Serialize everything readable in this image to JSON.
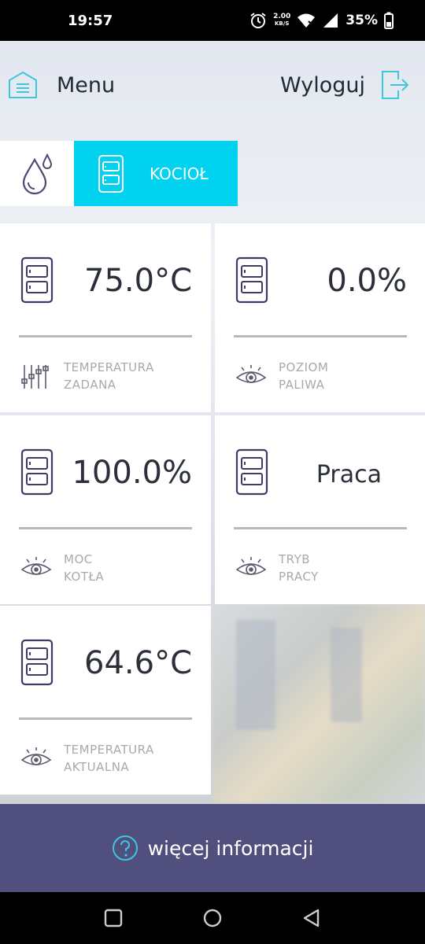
{
  "status_bar": {
    "time": "19:57",
    "net_speed_value": "2.00",
    "net_speed_unit": "KB/S",
    "battery": "35%"
  },
  "header": {
    "menu_label": "Menu",
    "logout_label": "Wyloguj",
    "accent_color": "#3cc8dc"
  },
  "tabs": {
    "active_label": "KOCIOŁ",
    "active_color": "#00d2ef"
  },
  "cards": [
    {
      "value": "75.0°C",
      "label_line1": "TEMPERATURA",
      "label_line2": "ZADANA",
      "label_icon": "sliders-icon"
    },
    {
      "value": "0.0%",
      "label_line1": "POZIOM",
      "label_line2": "PALIWA",
      "label_icon": "eye-icon"
    },
    {
      "value": "100.0%",
      "label_line1": "MOC",
      "label_line2": "KOTŁA",
      "label_icon": "eye-icon"
    },
    {
      "value": "Praca",
      "label_line1": "TRYB",
      "label_line2": "PRACY",
      "label_icon": "eye-icon"
    },
    {
      "value": "64.6°C",
      "label_line1": "TEMPERATURA",
      "label_line2": "AKTUALNA",
      "label_icon": "eye-icon"
    }
  ],
  "footer": {
    "more_info_label": "więcej informacji",
    "background_color": "#514f7d"
  }
}
